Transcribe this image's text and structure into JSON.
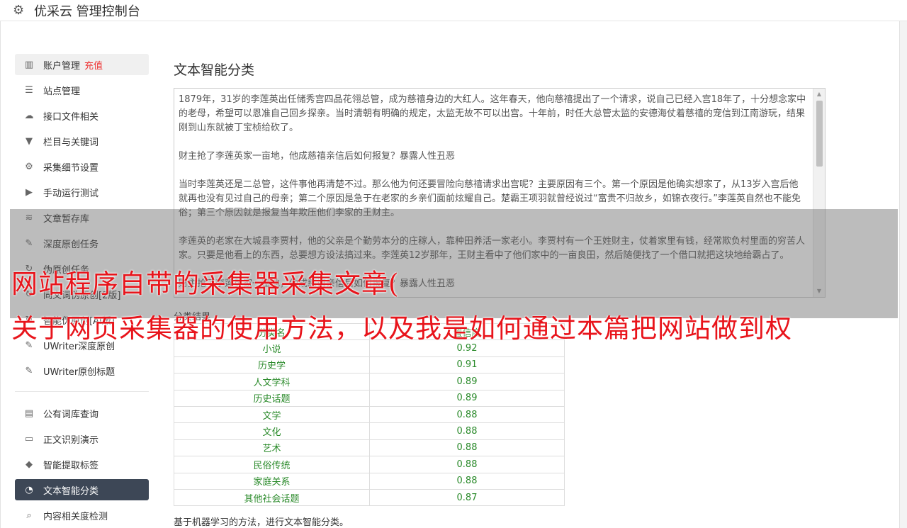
{
  "app": {
    "title": "优采云 管理控制台"
  },
  "sidebar": {
    "items": [
      {
        "icon": "bar-chart-icon",
        "label": "账户管理",
        "tag": "充值"
      },
      {
        "icon": "server-icon",
        "label": "站点管理"
      },
      {
        "icon": "cloud-upload-icon",
        "label": "接口文件相关"
      },
      {
        "icon": "filter-icon",
        "label": "栏目与关键词"
      },
      {
        "icon": "gears-icon",
        "label": "采集细节设置"
      },
      {
        "icon": "play-circle-icon",
        "label": "手动运行测试"
      },
      {
        "icon": "database-icon",
        "label": "文章暂存库"
      },
      {
        "icon": "edit-icon",
        "label": "深度原创任务"
      },
      {
        "icon": "refresh-icon",
        "label": "伪原创任务"
      },
      {
        "icon": "refresh-icon",
        "label": "同义词伪原创[2版]"
      },
      {
        "icon": "refresh-icon",
        "label": "智能伪原创[AI版]"
      },
      {
        "icon": "edit-icon",
        "label": "UWriter深度原创"
      },
      {
        "icon": "edit-icon",
        "label": "UWriter原创标题"
      }
    ],
    "items2": [
      {
        "icon": "book-icon",
        "label": "公有词库查询"
      },
      {
        "icon": "desktop-icon",
        "label": "正文识别演示"
      },
      {
        "icon": "tag-icon",
        "label": "智能提取标签"
      },
      {
        "icon": "pie-chart-icon",
        "label": "文本智能分类"
      },
      {
        "icon": "search-icon",
        "label": "内容相关度检测"
      }
    ]
  },
  "main": {
    "title": "文本智能分类",
    "input_paragraphs": [
      "1879年，31岁的李莲英出任储秀宫四品花翎总管，成为慈禧身边的大红人。这年春天，他向慈禧提出了一个请求，说自己已经入宫18年了，十分想念家中的老母，希望可以恩准自己回乡探亲。当时清朝有明确的规定，太监无故不可以出宫。十年前，时任大总管太监的安德海仗着慈禧的宠信到江南游玩，结果刚到山东就被丁宝桢给砍了。",
      "财主抢了李莲英家一亩地，他成慈禧亲信后如何报复？暴露人性丑恶",
      "当时李莲英还是二总管，这件事他再清楚不过。那么他为何还要冒险向慈禧请求出宫呢？主要原因有三个。第一个原因是他确实想家了，从13岁入宫后他就再也没有见过自己的母亲；第二个原因是急于在老家的乡亲们面前炫耀自己。楚霸王项羽就曾经说过“富贵不归故乡，如锦衣夜行。”李莲英自然也不能免俗；第三个原因就是报复当年欺压他们李家的王财主。",
      "李莲英的老家在大城县李贾村，他的父亲是个勤劳本分的庄稼人，靠种田养活一家老小。李贾村有一个王姓财主，仗着家里有钱，经常欺负村里面的穷苦人家。只要是他看上的东西，总要想方设法搞过来。李莲英12岁那年，王财主看中了他们家中的一亩良田，然后随便找了一个借口就把这块地给霸占了。",
      "财主抢了李莲英家一亩地，他成慈禧亲信后如何报复？暴露人性丑恶"
    ],
    "result_title": "分类结果",
    "columns": [
      "分类名",
      "置信度"
    ],
    "rows": [
      [
        "小说",
        "0.92"
      ],
      [
        "历史学",
        "0.91"
      ],
      [
        "人文学科",
        "0.89"
      ],
      [
        "历史话题",
        "0.89"
      ],
      [
        "文学",
        "0.88"
      ],
      [
        "文化",
        "0.88"
      ],
      [
        "艺术",
        "0.88"
      ],
      [
        "民俗传统",
        "0.88"
      ],
      [
        "家庭关系",
        "0.88"
      ],
      [
        "其他社会话题",
        "0.87"
      ]
    ],
    "footnote": "基于机器学习的方法，进行文本智能分类。"
  },
  "overlay": {
    "line1": "网站程序自带的采集器采集文章(",
    "line2": "关于网页采集器的使用方法，以及我是如何通过本篇把网站做到权"
  },
  "colors": {
    "active_nav_bg": "#3d4756",
    "tag_red": "#e33333",
    "value_green": "#2a8a2a",
    "banner_red": "#e8141b"
  }
}
